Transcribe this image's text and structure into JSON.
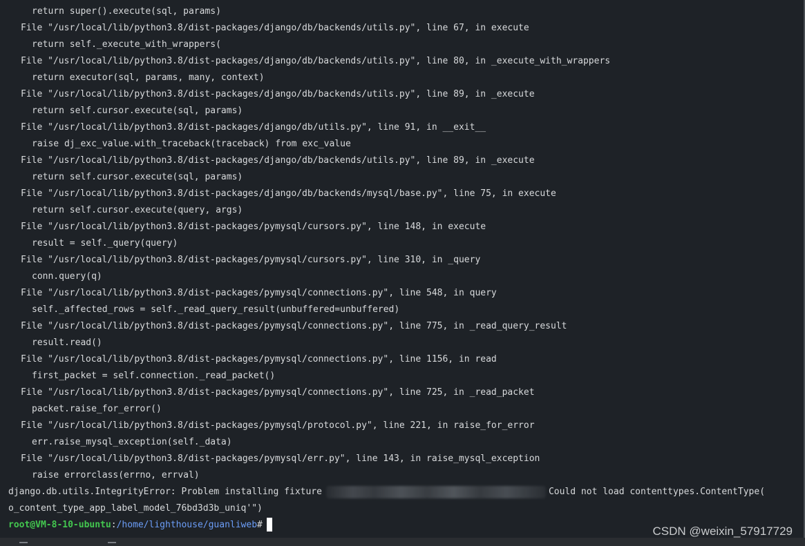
{
  "terminal": {
    "lines": [
      {
        "indent": 2,
        "text": "return super().execute(sql, params)"
      },
      {
        "indent": 1,
        "text": "File \"/usr/local/lib/python3.8/dist-packages/django/db/backends/utils.py\", line 67, in execute"
      },
      {
        "indent": 2,
        "text": "return self._execute_with_wrappers("
      },
      {
        "indent": 1,
        "text": "File \"/usr/local/lib/python3.8/dist-packages/django/db/backends/utils.py\", line 80, in _execute_with_wrappers"
      },
      {
        "indent": 2,
        "text": "return executor(sql, params, many, context)"
      },
      {
        "indent": 1,
        "text": "File \"/usr/local/lib/python3.8/dist-packages/django/db/backends/utils.py\", line 89, in _execute"
      },
      {
        "indent": 2,
        "text": "return self.cursor.execute(sql, params)"
      },
      {
        "indent": 1,
        "text": "File \"/usr/local/lib/python3.8/dist-packages/django/db/utils.py\", line 91, in __exit__"
      },
      {
        "indent": 2,
        "text": "raise dj_exc_value.with_traceback(traceback) from exc_value"
      },
      {
        "indent": 1,
        "text": "File \"/usr/local/lib/python3.8/dist-packages/django/db/backends/utils.py\", line 89, in _execute"
      },
      {
        "indent": 2,
        "text": "return self.cursor.execute(sql, params)"
      },
      {
        "indent": 1,
        "text": "File \"/usr/local/lib/python3.8/dist-packages/django/db/backends/mysql/base.py\", line 75, in execute"
      },
      {
        "indent": 2,
        "text": "return self.cursor.execute(query, args)"
      },
      {
        "indent": 1,
        "text": "File \"/usr/local/lib/python3.8/dist-packages/pymysql/cursors.py\", line 148, in execute"
      },
      {
        "indent": 2,
        "text": "result = self._query(query)"
      },
      {
        "indent": 1,
        "text": "File \"/usr/local/lib/python3.8/dist-packages/pymysql/cursors.py\", line 310, in _query"
      },
      {
        "indent": 2,
        "text": "conn.query(q)"
      },
      {
        "indent": 1,
        "text": "File \"/usr/local/lib/python3.8/dist-packages/pymysql/connections.py\", line 548, in query"
      },
      {
        "indent": 2,
        "text": "self._affected_rows = self._read_query_result(unbuffered=unbuffered)"
      },
      {
        "indent": 1,
        "text": "File \"/usr/local/lib/python3.8/dist-packages/pymysql/connections.py\", line 775, in _read_query_result"
      },
      {
        "indent": 2,
        "text": "result.read()"
      },
      {
        "indent": 1,
        "text": "File \"/usr/local/lib/python3.8/dist-packages/pymysql/connections.py\", line 1156, in read"
      },
      {
        "indent": 2,
        "text": "first_packet = self.connection._read_packet()"
      },
      {
        "indent": 1,
        "text": "File \"/usr/local/lib/python3.8/dist-packages/pymysql/connections.py\", line 725, in _read_packet"
      },
      {
        "indent": 2,
        "text": "packet.raise_for_error()"
      },
      {
        "indent": 1,
        "text": "File \"/usr/local/lib/python3.8/dist-packages/pymysql/protocol.py\", line 221, in raise_for_error"
      },
      {
        "indent": 2,
        "text": "err.raise_mysql_exception(self._data)"
      },
      {
        "indent": 1,
        "text": "File \"/usr/local/lib/python3.8/dist-packages/pymysql/err.py\", line 143, in raise_mysql_exception"
      },
      {
        "indent": 2,
        "text": "raise errorclass(errno, errval)"
      }
    ],
    "error_line": {
      "before": "django.db.utils.IntegrityError: Problem installing fixture",
      "after": "Could not load contenttypes.ContentType("
    },
    "error_continuation": "o_content_type_app_label_model_76bd3d3b_uniq'\")",
    "prompt": {
      "user_host": "root@VM-8-10-ubuntu",
      "colon": ":",
      "path": "/home/lighthouse/guanliweb",
      "symbol": "#"
    }
  },
  "watermark": "CSDN @weixin_57917729",
  "colors": {
    "background": "#1e2227",
    "text": "#d8dadc",
    "user": "#43c74f",
    "path": "#6c9ef8"
  }
}
